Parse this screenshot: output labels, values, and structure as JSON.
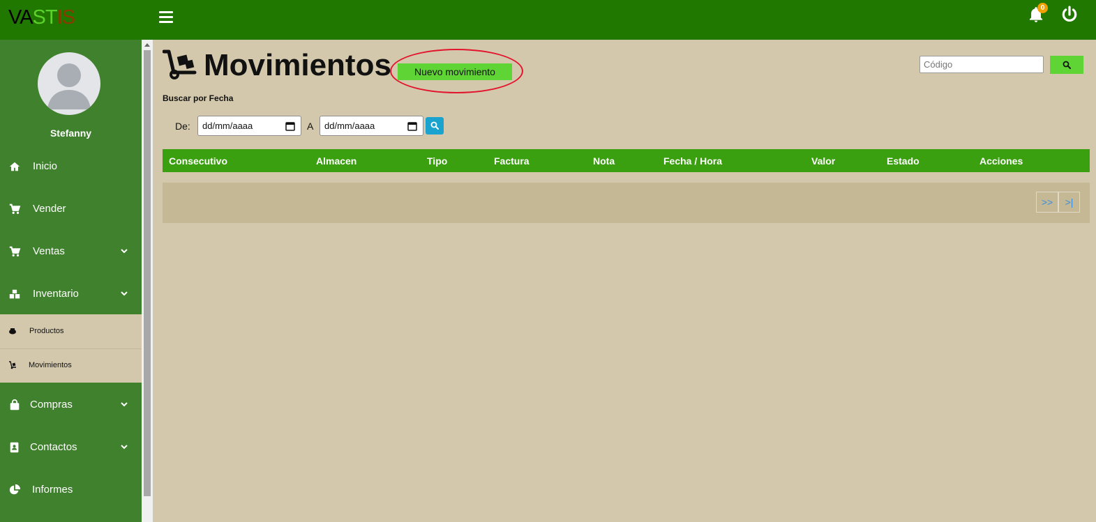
{
  "header": {
    "logo": {
      "part1": "VA",
      "part2": "ST",
      "part3": "IS"
    },
    "notifications_count": "0"
  },
  "sidebar": {
    "username": "Stefanny",
    "items": [
      {
        "label": "Inicio",
        "icon": "home-icon"
      },
      {
        "label": "Vender",
        "icon": "cart-plus-icon"
      },
      {
        "label": "Ventas",
        "icon": "cart-icon"
      },
      {
        "label": "Inventario",
        "icon": "boxes-icon"
      },
      {
        "label": "Compras",
        "icon": "shopping-bag-icon"
      },
      {
        "label": "Contactos",
        "icon": "address-book-icon"
      },
      {
        "label": "Informes",
        "icon": "pie-chart-icon"
      }
    ],
    "submenu": [
      {
        "label": "Productos",
        "icon": "product-icon"
      },
      {
        "label": "Movimientos",
        "icon": "dolly-icon"
      }
    ]
  },
  "main": {
    "title": "Movimientos",
    "new_button": "Nuevo movimiento",
    "search_by_date_label": "Buscar por Fecha",
    "from_label": "De:",
    "to_label": "A",
    "date_placeholder": "dd/mm/aaaa",
    "code_placeholder": "Código"
  },
  "table": {
    "columns": [
      "Consecutivo",
      "Almacen",
      "Tipo",
      "Factura",
      "Nota",
      "Fecha / Hora",
      "Valor",
      "Estado",
      "Acciones"
    ],
    "pager_next": ">>",
    "pager_last": ">|"
  },
  "colors": {
    "topbar": "#217800",
    "sidebar": "#3f812c",
    "background": "#d3c8ab",
    "table_header": "#3aa00f",
    "accent_button": "#5fd535",
    "highlight": "#e3132c"
  }
}
